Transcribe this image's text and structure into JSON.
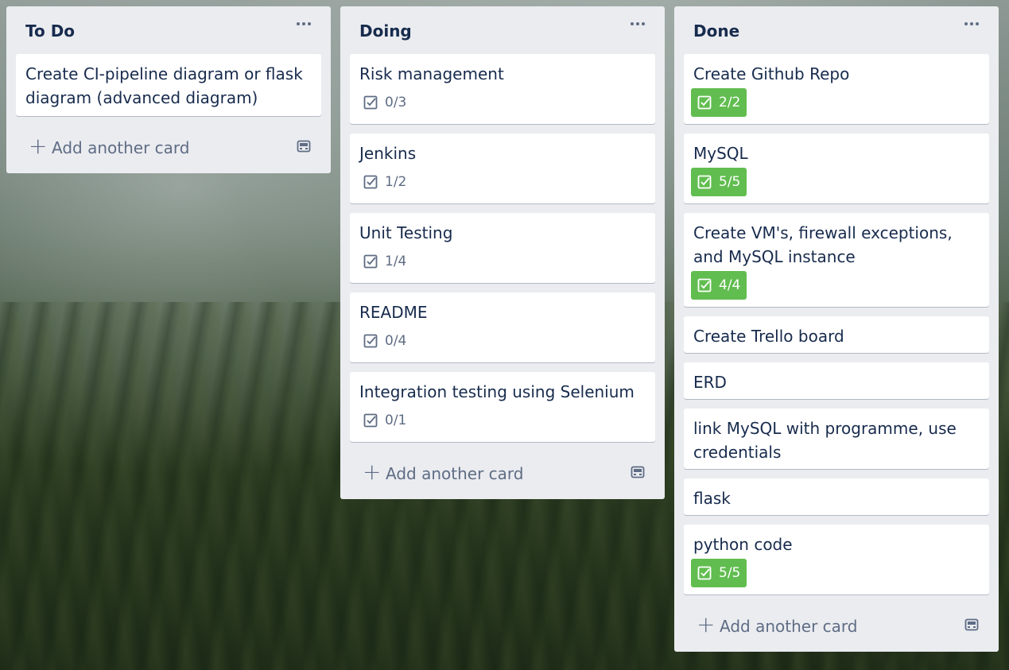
{
  "lists": [
    {
      "title": "To Do",
      "add_label": "Add another card",
      "cards": [
        {
          "title": "Create CI-pipeline diagram or flask diagram (advanced diagram)"
        }
      ]
    },
    {
      "title": "Doing",
      "add_label": "Add another card",
      "cards": [
        {
          "title": "Risk management",
          "checklist": "0/3"
        },
        {
          "title": "Jenkins",
          "checklist": "1/2"
        },
        {
          "title": "Unit Testing",
          "checklist": "1/4"
        },
        {
          "title": "README",
          "checklist": "0/4"
        },
        {
          "title": "Integration testing using Selenium",
          "checklist": "0/1"
        }
      ]
    },
    {
      "title": "Done",
      "add_label": "Add another card",
      "cards": [
        {
          "title": "Create Github Repo",
          "checklist": "2/2"
        },
        {
          "title": "MySQL",
          "checklist": "5/5"
        },
        {
          "title": "Create VM's, firewall exceptions, and MySQL instance",
          "checklist": "4/4"
        },
        {
          "title": "Create Trello board"
        },
        {
          "title": "ERD"
        },
        {
          "title": "link MySQL with programme, use credentials"
        },
        {
          "title": "flask"
        },
        {
          "title": "python code",
          "checklist": "5/5"
        }
      ]
    }
  ],
  "colors": {
    "list_bg": "#ebecf0",
    "complete_badge": "#61bd4f",
    "text": "#172b4d",
    "muted": "#5e6c84"
  },
  "icons": {
    "menu": "ellipsis-icon",
    "checklist": "checklist-icon",
    "add": "plus-icon",
    "template": "card-template-icon"
  }
}
